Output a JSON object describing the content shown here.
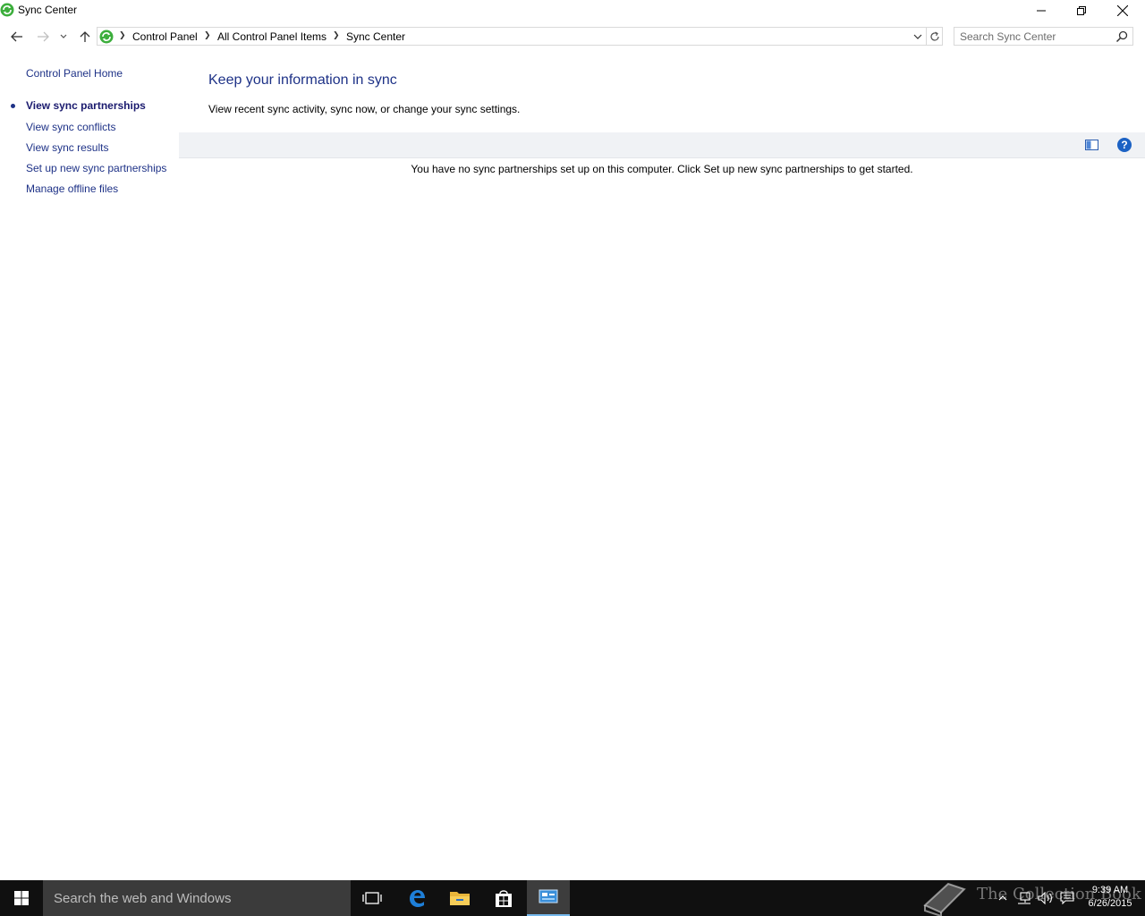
{
  "window": {
    "title": "Sync Center"
  },
  "titlebar": {
    "minimize": "minimize-icon",
    "restore": "restore-icon",
    "close": "close-icon"
  },
  "address": {
    "crumbs": [
      "Control Panel",
      "All Control Panel Items",
      "Sync Center"
    ]
  },
  "search": {
    "placeholder": "Search Sync Center"
  },
  "sidebar": {
    "home": "Control Panel Home",
    "items": [
      {
        "label": "View sync partnerships",
        "active": true
      },
      {
        "label": "View sync conflicts",
        "active": false
      },
      {
        "label": "View sync results",
        "active": false
      },
      {
        "label": "Set up new sync partnerships",
        "active": false
      },
      {
        "label": "Manage offline files",
        "active": false
      }
    ]
  },
  "main": {
    "title": "Keep your information in sync",
    "description": "View recent sync activity, sync now, or change your sync settings.",
    "empty_message": "You have no sync partnerships set up on this computer. Click Set up new sync partnerships to get started.",
    "help_glyph": "?"
  },
  "taskbar": {
    "search_placeholder": "Search the web and Windows",
    "time": "9:39 AM",
    "date": "6/26/2015",
    "watermark": "The Collection Book"
  },
  "colors": {
    "link": "#1e3287",
    "title": "#1e3287",
    "taskbar": "#101010",
    "accent": "#76b9ed"
  }
}
